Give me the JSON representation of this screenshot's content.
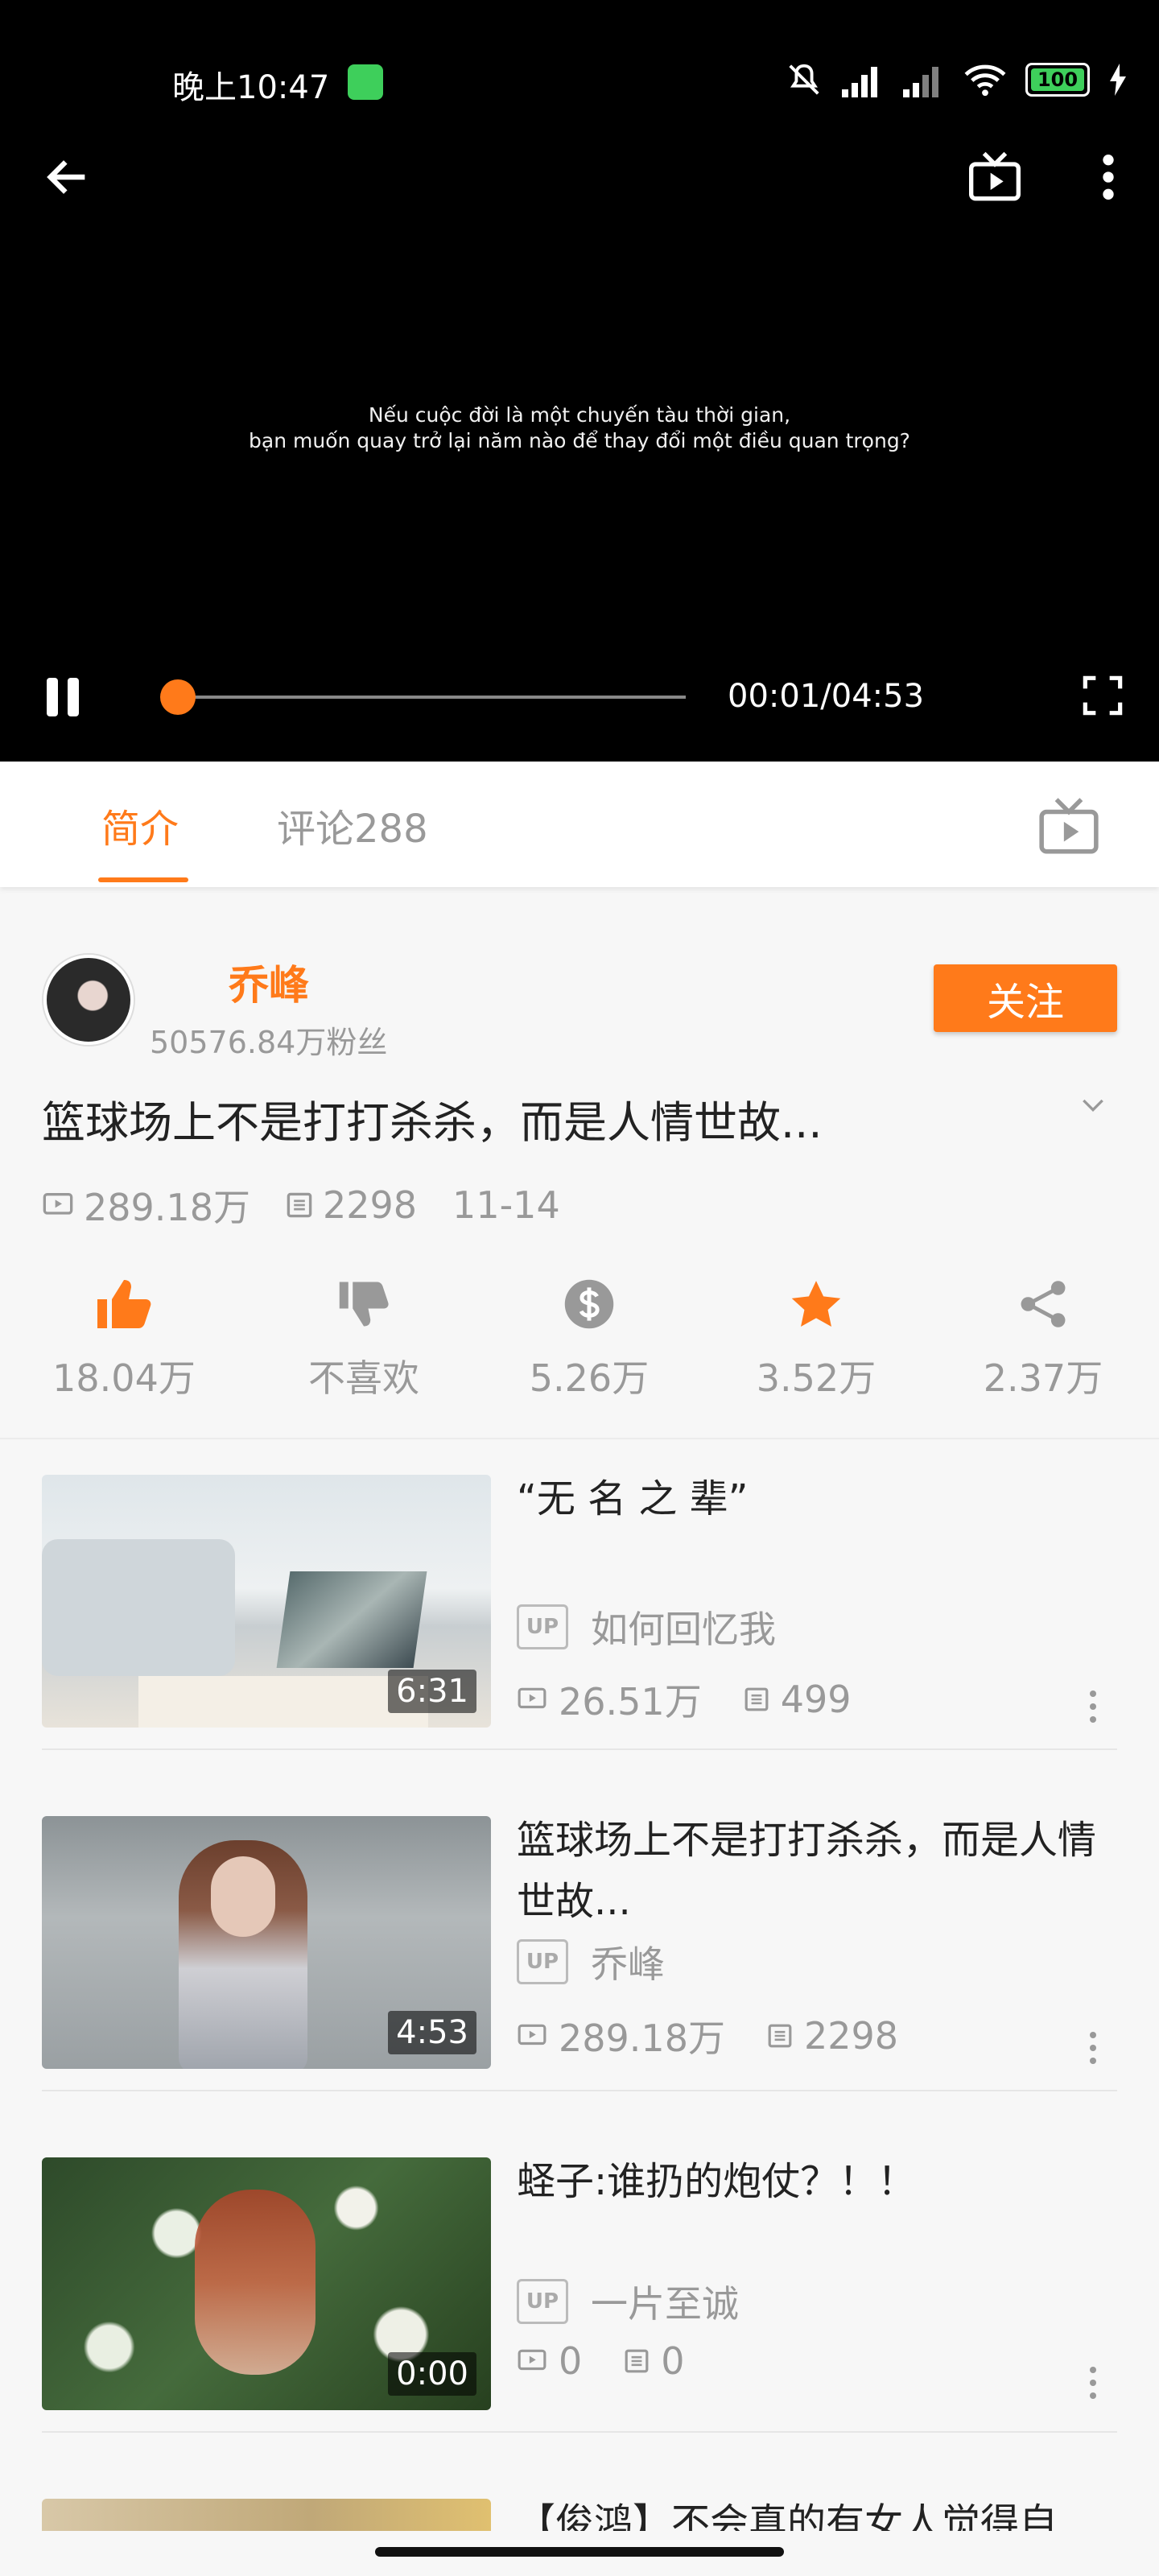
{
  "status_bar": {
    "time": "晚上10:47",
    "battery": "100"
  },
  "player": {
    "subtitle_lines": [
      "Nếu cuộc đời là một chuyến tàu thời gian,",
      "bạn muốn quay trở lại năm nào để thay đổi một điều quan trọng?"
    ],
    "time_display": "00:01/04:53",
    "progress": 0.02
  },
  "tabs": {
    "intro": "简介",
    "comments": "评论288"
  },
  "uploader": {
    "name": "乔峰",
    "fans": "50576.84万粉丝",
    "follow": "关注"
  },
  "video": {
    "title": "篮球场上不是打打杀杀，而是人情世故...",
    "plays": "289.18万",
    "danmaku": "2298",
    "date": "11-14"
  },
  "actions": {
    "like": "18.04万",
    "dislike": "不喜欢",
    "coin": "5.26万",
    "favorite": "3.52万",
    "share": "2.37万"
  },
  "colors": {
    "accent": "#ff7a1a",
    "text_muted": "#999999"
  },
  "recommendations": [
    {
      "title": "“无 名 之 辈”",
      "duration": "6:31",
      "up_badge": "UP",
      "uploader": "如何回忆我",
      "plays": "26.51万",
      "danmaku": "499"
    },
    {
      "title": "篮球场上不是打打杀杀，而是人情世故...",
      "duration": "4:53",
      "up_badge": "UP",
      "uploader": "乔峰",
      "plays": "289.18万",
      "danmaku": "2298"
    },
    {
      "title": "蛏子:谁扔的炮仗？！！",
      "duration": "0:00",
      "up_badge": "UP",
      "uploader": "一片至诚",
      "plays": "0",
      "danmaku": "0"
    },
    {
      "title": "【俊鸿】不会真的有女人觉得自"
    }
  ]
}
